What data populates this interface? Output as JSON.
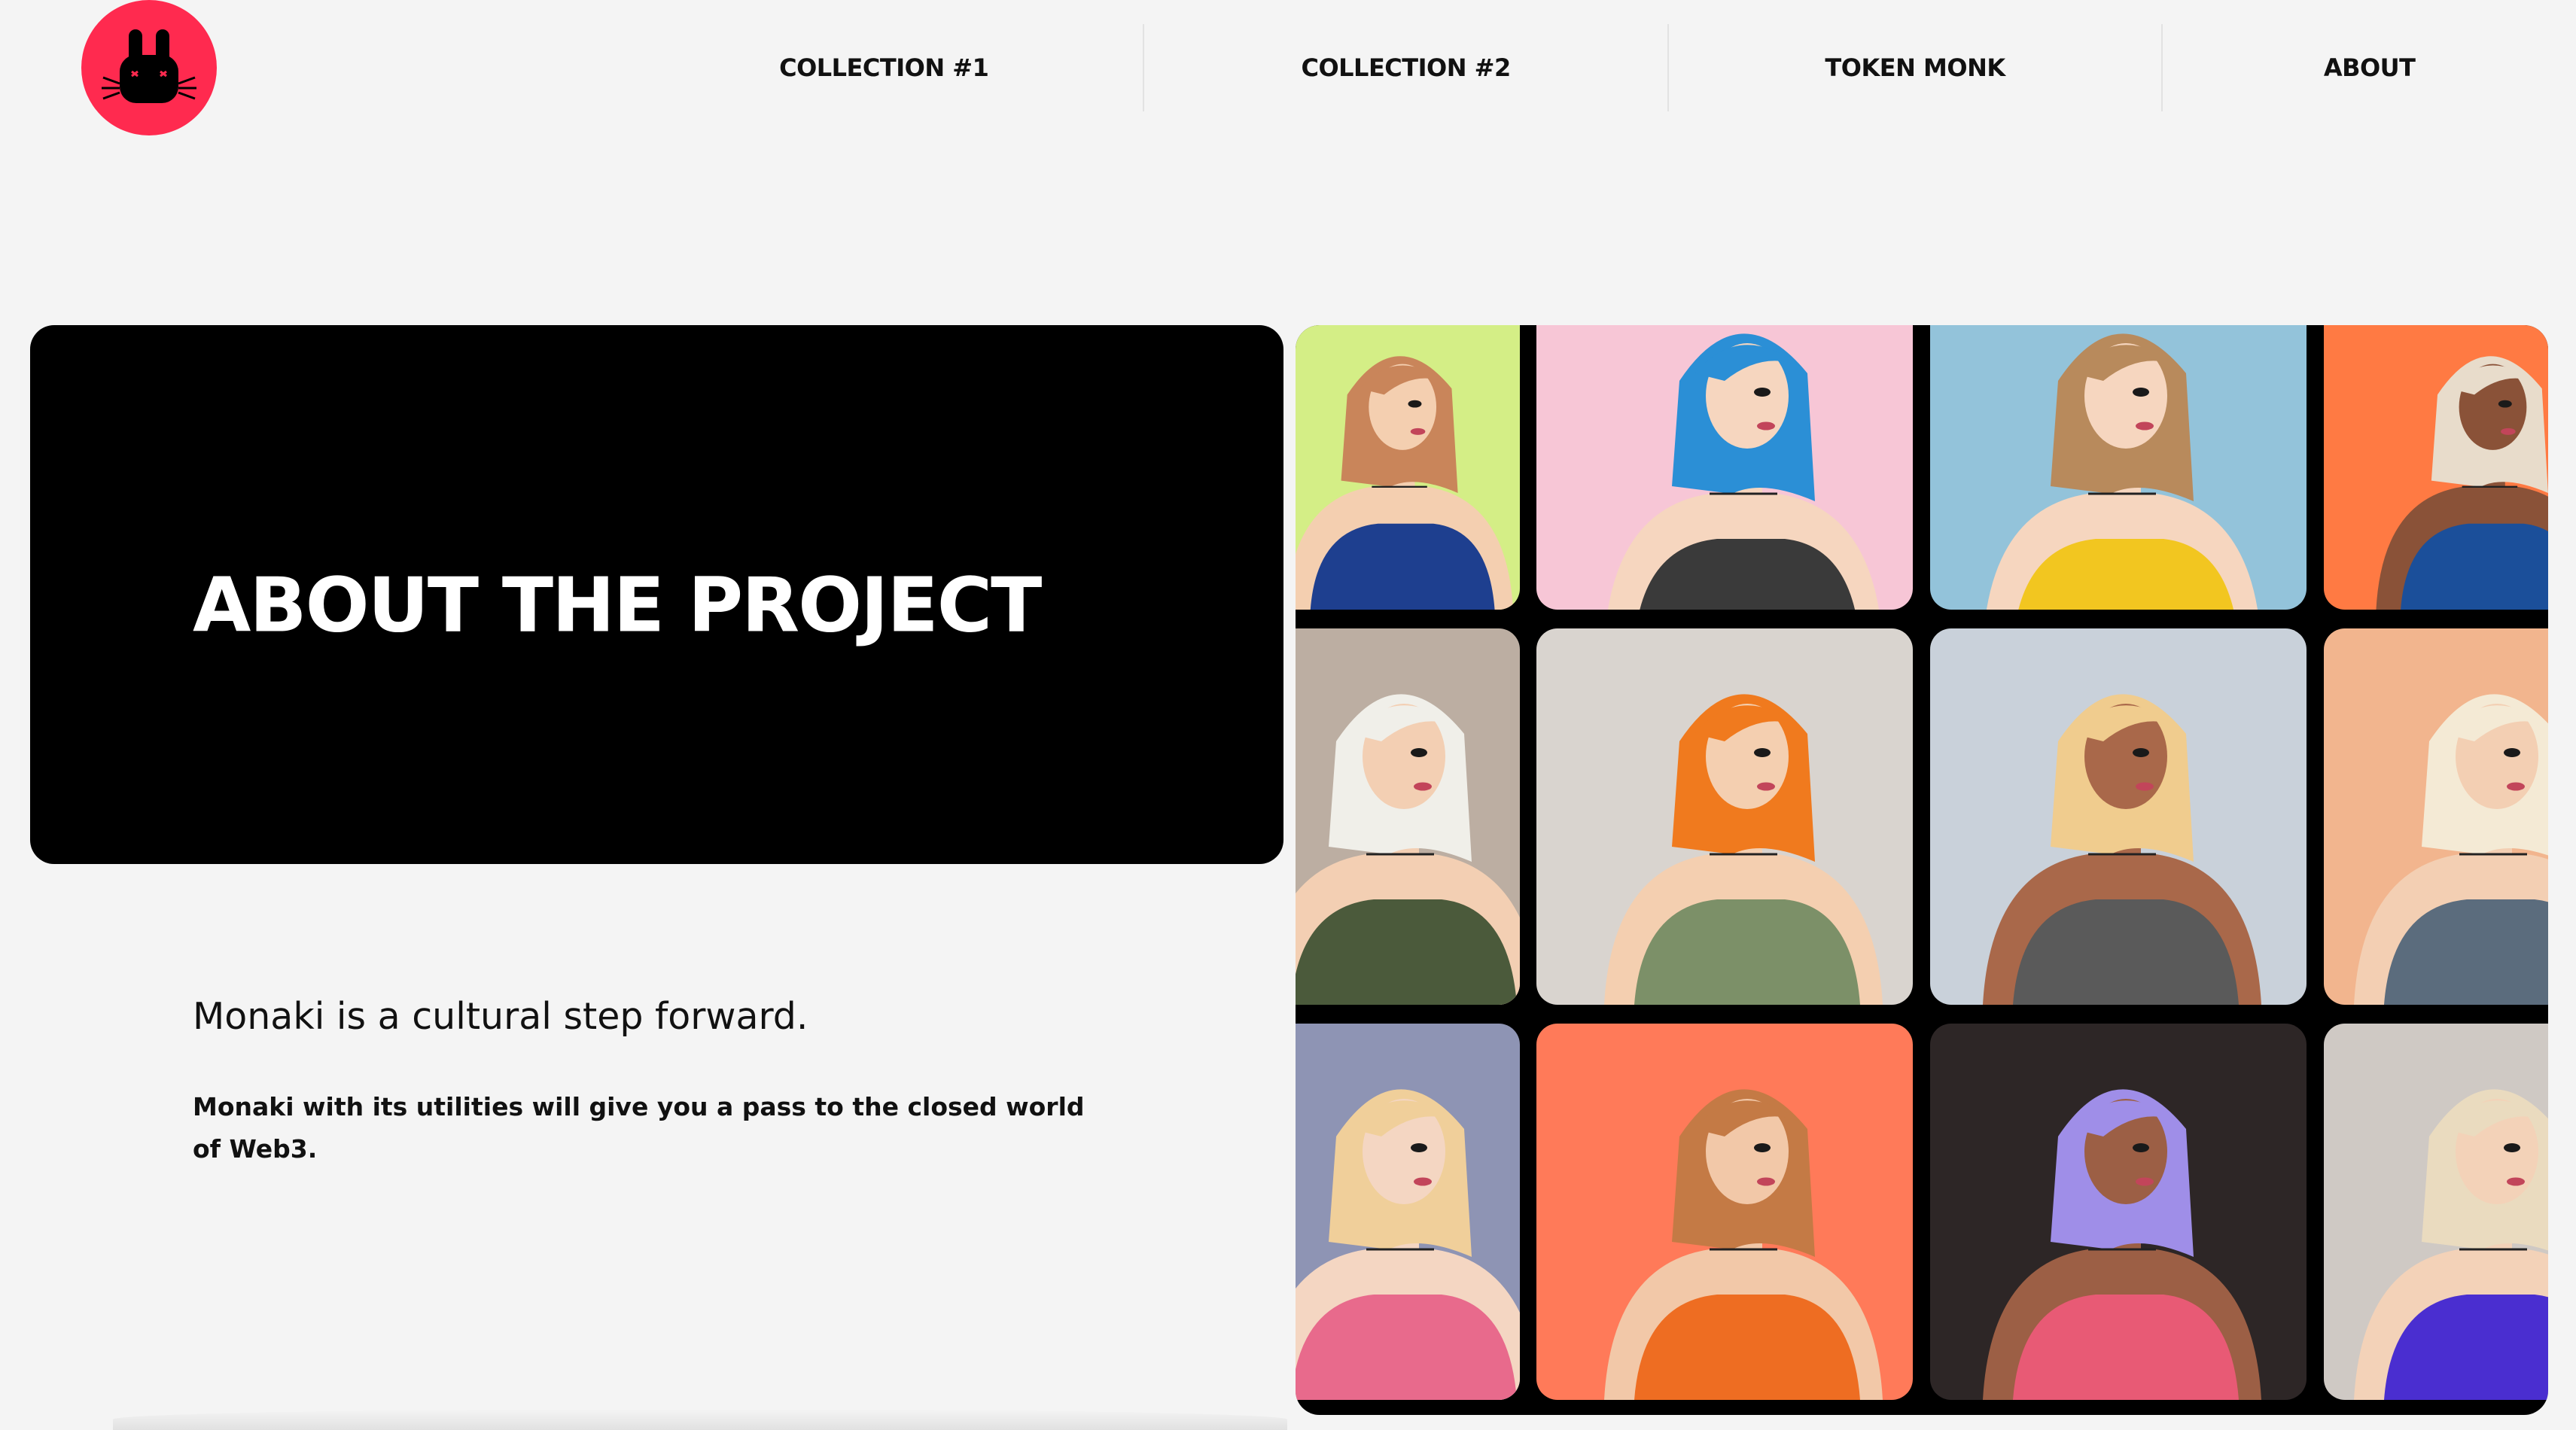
{
  "header": {
    "logo_icon": "rabbit-logo-icon",
    "brand_color": "#ff2a4f",
    "nav": [
      {
        "label": "COLLECTION #1"
      },
      {
        "label": "COLLECTION #2"
      },
      {
        "label": "TOKEN MONK"
      },
      {
        "label": "ABOUT"
      }
    ]
  },
  "hero": {
    "title": "ABOUT THE PROJECT"
  },
  "intro": {
    "subtitle": "Monaki is a cultural step forward.",
    "body": "Monaki with its utilities will give you a pass to the closed world of Web3."
  },
  "gallery": {
    "tiles": [
      {
        "bg": "#d4ee86",
        "hair": "#c9855a",
        "top": "#1e3f8f",
        "skin": "#f4cfb0"
      },
      {
        "bg": "#f7c6d6",
        "hair": "#2b8fd6",
        "top": "#3a3a3a",
        "skin": "#f6d6bf"
      },
      {
        "bg": "#93c3da",
        "hair": "#b88a5c",
        "top": "#f2c620",
        "skin": "#f6d6bf"
      },
      {
        "bg": "#ff7a43",
        "hair": "#e8dccb",
        "top": "#1b4f9a",
        "skin": "#8a5238"
      },
      {
        "bg": "#bcaea2",
        "hair": "#f0efe9",
        "top": "#4b5a3b",
        "skin": "#f3cfb3"
      },
      {
        "bg": "#d9d4cf",
        "hair": "#f07a1e",
        "top": "#7c9068",
        "skin": "#f4cfb0"
      },
      {
        "bg": "#c9d1da",
        "hair": "#f0cc8e",
        "top": "#5a5a5a",
        "skin": "#a9684a"
      },
      {
        "bg": "#f2b58e",
        "hair": "#f4ead5",
        "top": "#5b6c7d",
        "skin": "#f3cfb3"
      },
      {
        "bg": "#8e94b4",
        "hair": "#f0cf9a",
        "top": "#e86a8c",
        "skin": "#f4d6c2"
      },
      {
        "bg": "#ff7a59",
        "hair": "#c47a45",
        "top": "#ee6d22",
        "skin": "#f2c8a8"
      },
      {
        "bg": "#2d2626",
        "hair": "#9f8ee8",
        "top": "#e85a75",
        "skin": "#9c5f45"
      },
      {
        "bg": "#cfc9c4",
        "hair": "#eadbbf",
        "top": "#4a2ed0",
        "skin": "#f3d2b8"
      }
    ]
  }
}
